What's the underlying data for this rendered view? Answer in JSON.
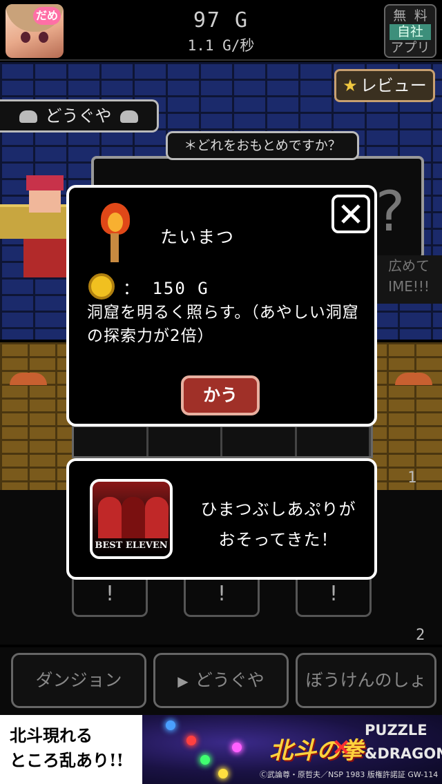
{
  "header": {
    "avatar_badge": "だめ",
    "gold": "97 G",
    "rate": "1.1 G/秒",
    "free_app": [
      "無 料",
      "自社",
      "アプリ"
    ]
  },
  "scene": {
    "review_label": "レビュー",
    "shop_title": "どうぐや",
    "prompt": "＊どれをおもとめですか？",
    "question_mark": "?",
    "share_hint_1": "広めて",
    "share_hint_2": "IME!!!"
  },
  "item_modal": {
    "item_name": "たいまつ",
    "price": "： 150 G",
    "description": "洞窟を明るく照らす。（あやしい洞窟の探索力が2倍）",
    "buy_label": "かう"
  },
  "promo": {
    "icon_label": "BEST ELEVEN",
    "text_line1": "ひまつぶしあぷりが",
    "text_line2": "おそってきた！"
  },
  "lower": {
    "count_1": "1",
    "count_2": "2",
    "slot_marks": [
      "!",
      "!",
      "!"
    ]
  },
  "nav": {
    "items": [
      {
        "label": "ダンジョン"
      },
      {
        "label": "どうぐや"
      },
      {
        "label": "ぼうけんのしょ"
      }
    ],
    "active_marker": "▶"
  },
  "ad": {
    "left_line1": "北斗現れる",
    "left_line2": "ところ乱あり!!",
    "title": "北斗の拳",
    "times": "×",
    "pd_line1": "PUZZLE",
    "pd_line2": "&DRAGONS",
    "copyright": "Ⓒ武論尊・原哲夫／NSP 1983 版権許諾証 GW-114"
  }
}
